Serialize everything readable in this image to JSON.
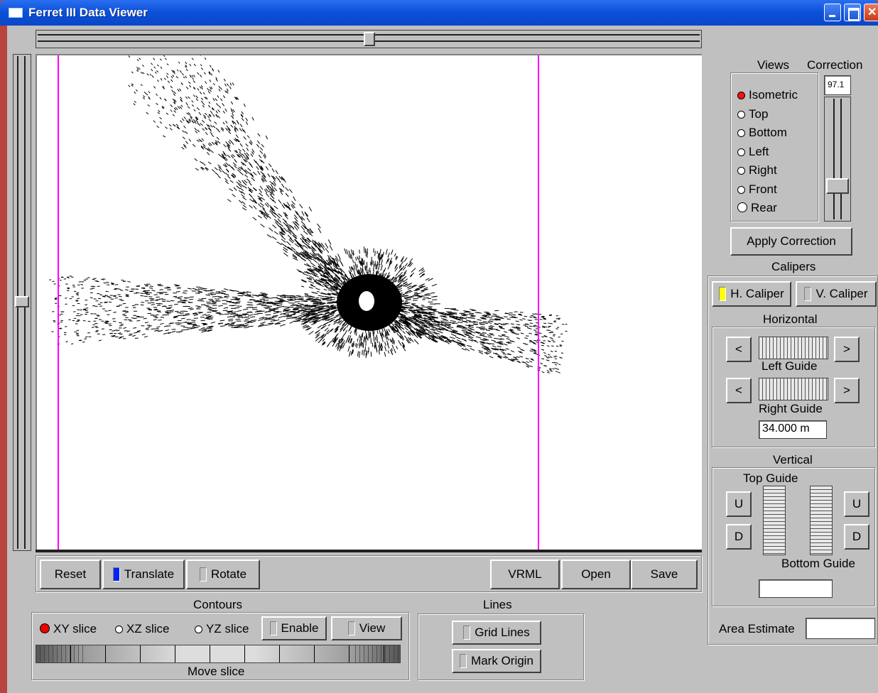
{
  "window": {
    "title": "Ferret III Data Viewer"
  },
  "toolbar": {
    "reset": "Reset",
    "translate": "Translate",
    "rotate": "Rotate",
    "vrml": "VRML",
    "open": "Open",
    "save": "Save"
  },
  "views": {
    "header": "Views",
    "correction_header": "Correction",
    "correction_value": "97.1",
    "options": [
      "Isometric",
      "Top",
      "Bottom",
      "Left",
      "Right",
      "Front",
      "Rear"
    ],
    "selected": "Isometric",
    "apply_correction": "Apply Correction"
  },
  "calipers": {
    "header": "Calipers",
    "h_caliper": "H. Caliper",
    "v_caliper": "V. Caliper",
    "horizontal": {
      "header": "Horizontal",
      "left_guide": "Left Guide",
      "right_guide": "Right Guide",
      "prev": "<",
      "next": ">",
      "measurement": "34.000 m"
    },
    "vertical": {
      "header": "Vertical",
      "top_guide": "Top Guide",
      "bottom_guide": "Bottom Guide",
      "up": "U",
      "down": "D",
      "measurement": ""
    },
    "area_estimate_label": "Area Estimate",
    "area_estimate_value": ""
  },
  "contours": {
    "header": "Contours",
    "xy": "XY slice",
    "xz": "XZ slice",
    "yz": "YZ slice",
    "selected": "XY slice",
    "enable": "Enable",
    "view": "View",
    "move_slice": "Move slice"
  },
  "lines": {
    "header": "Lines",
    "grid_lines": "Grid Lines",
    "mark_origin": "Mark Origin"
  },
  "colors": {
    "caliper_line": "#ff00ff",
    "translate_active": "#0024f5",
    "h_caliper_active": "#ffff00",
    "radio_selected": "#ff0000"
  }
}
